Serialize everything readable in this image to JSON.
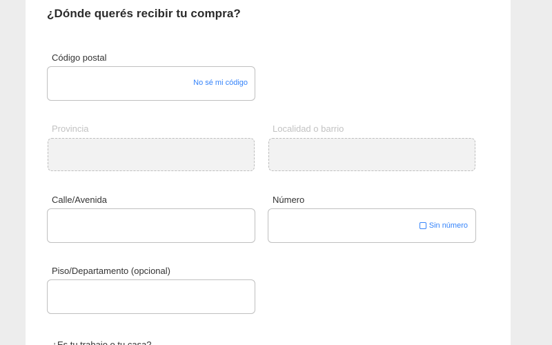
{
  "section": {
    "title": "¿Dónde querés recibir tu compra?"
  },
  "fields": {
    "postal_code": {
      "label": "Código postal",
      "value": "",
      "link": "No sé mi código"
    },
    "province": {
      "label": "Provincia",
      "value": ""
    },
    "locality": {
      "label": "Localidad o barrio",
      "value": ""
    },
    "street": {
      "label": "Calle/Avenida",
      "value": ""
    },
    "number": {
      "label": "Número",
      "value": "",
      "checkbox_label": "Sin número"
    },
    "floor_apartment": {
      "label": "Piso/Departamento (opcional)",
      "value": ""
    },
    "next_question": {
      "label": "¿Es tu trabajo o tu casa?"
    }
  },
  "colors": {
    "accent": "#3483fa",
    "page_background": "#ededed",
    "card_background": "#ffffff",
    "disabled_field": "#f2f2f2"
  }
}
